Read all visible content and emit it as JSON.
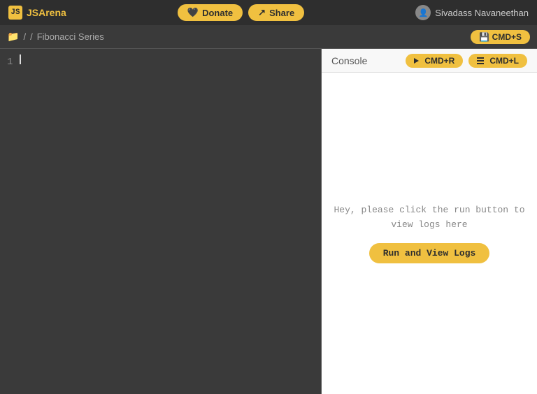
{
  "header": {
    "logo_text": "JSArena",
    "donate_label": "Donate",
    "share_label": "Share",
    "user_name": "Sivadass Navaneethan"
  },
  "toolbar": {
    "breadcrumb_root": "/",
    "breadcrumb_file": "Fibonacci Series",
    "save_label": "CMD+S"
  },
  "console_header": {
    "title": "Console",
    "run_label": "CMD+R",
    "log_label": "CMD+L"
  },
  "editor": {
    "line_number": "1",
    "content": ""
  },
  "console_body": {
    "message_line1": "Hey, please click the run button to",
    "message_line2": "view logs here",
    "run_view_label": "Run and View Logs"
  }
}
